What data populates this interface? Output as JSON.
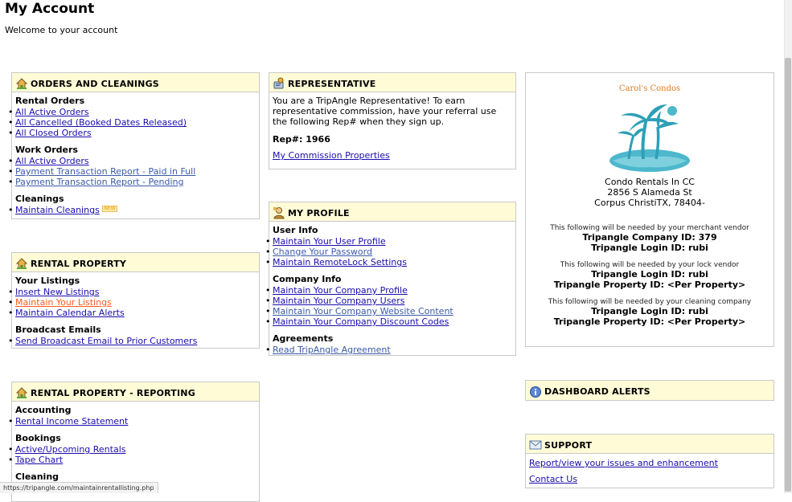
{
  "page": {
    "title": "My Account",
    "welcome": "Welcome to your account"
  },
  "orders": {
    "title": "ORDERS AND CLEANINGS",
    "rental_orders": {
      "heading": "Rental Orders",
      "links": [
        "All Active Orders",
        "All Cancelled (Booked Dates Released)",
        "All Closed Orders"
      ]
    },
    "work_orders": {
      "heading": "Work Orders",
      "links": [
        "All Active Orders",
        "Payment Transaction Report - Paid in Full",
        "Payment Transaction Report - Pending"
      ]
    },
    "cleanings": {
      "heading": "Cleanings",
      "links": [
        "Maintain Cleanings"
      ],
      "badge": "NEW"
    }
  },
  "rental_property": {
    "title": "RENTAL PROPERTY",
    "listings": {
      "heading": "Your Listings",
      "links": [
        "Insert New Listings",
        "Maintain Your Listings",
        "Maintain Calendar Alerts"
      ]
    },
    "broadcast": {
      "heading": "Broadcast Emails",
      "links": [
        "Send Broadcast Email to Prior Customers"
      ]
    }
  },
  "reporting": {
    "title": "RENTAL PROPERTY - REPORTING",
    "accounting": {
      "heading": "Accounting",
      "links": [
        "Rental Income Statement"
      ]
    },
    "bookings": {
      "heading": "Bookings",
      "links": [
        "Active/Upcoming Rentals",
        "Tape Chart"
      ]
    },
    "cleaning": {
      "heading": "Cleaning"
    }
  },
  "representative": {
    "title": "REPRESENTATIVE",
    "text": "You are a TripAngle Representative! To earn representative commission, have your referral use the following Rep# when they sign up.",
    "rep_number": "Rep#: 1966",
    "link": "My Commission Properties"
  },
  "profile": {
    "title": "MY PROFILE",
    "user_info": {
      "heading": "User Info",
      "links": [
        "Maintain Your User Profile",
        "Change Your Password",
        "Maintain RemoteLock Settings"
      ]
    },
    "company_info": {
      "heading": "Company Info",
      "links": [
        "Maintain Your Company Profile",
        "Maintain Your Company Users",
        "Maintain Your Company Website Content",
        "Maintain Your Company Discount Codes"
      ]
    },
    "agreements": {
      "heading": "Agreements",
      "links": [
        "Read TripAngle Agreement"
      ]
    }
  },
  "company_card": {
    "brand": "Carol's Condos",
    "name": "Condo Rentals In CC",
    "street": "2856 S Alameda St",
    "city": "Corpus ChristiTX, 78404-",
    "merchant_note": "This following will be needed by your merchant vendor",
    "merchant_company_id": "Tripangle Company ID: 379",
    "merchant_login_id": "Tripangle Login ID: rubi",
    "lock_note": "This following will be needed by your lock vendor",
    "lock_login_id": "Tripangle Login ID: rubi",
    "lock_property_id": "Tripangle Property ID: <Per Property>",
    "cleaning_note": "This following will be needed by your cleaning company",
    "cleaning_login_id": "Tripangle Login ID: rubi",
    "cleaning_property_id": "Tripangle Property ID: <Per Property>"
  },
  "dashboard_alerts": {
    "title": "DASHBOARD ALERTS"
  },
  "support": {
    "title": "SUPPORT",
    "links": [
      "Report/view your issues and enhancement",
      "Contact Us"
    ]
  },
  "status_bar": {
    "url": "https://tripangle.com/maintainrentallisting.php"
  },
  "colors": {
    "panel_header_bg": "#fffbd6",
    "link": "#1a0dab",
    "link_hover": "#ff5a1f",
    "brand": "#e07a1f",
    "logo_teal": "#3db2c9"
  }
}
